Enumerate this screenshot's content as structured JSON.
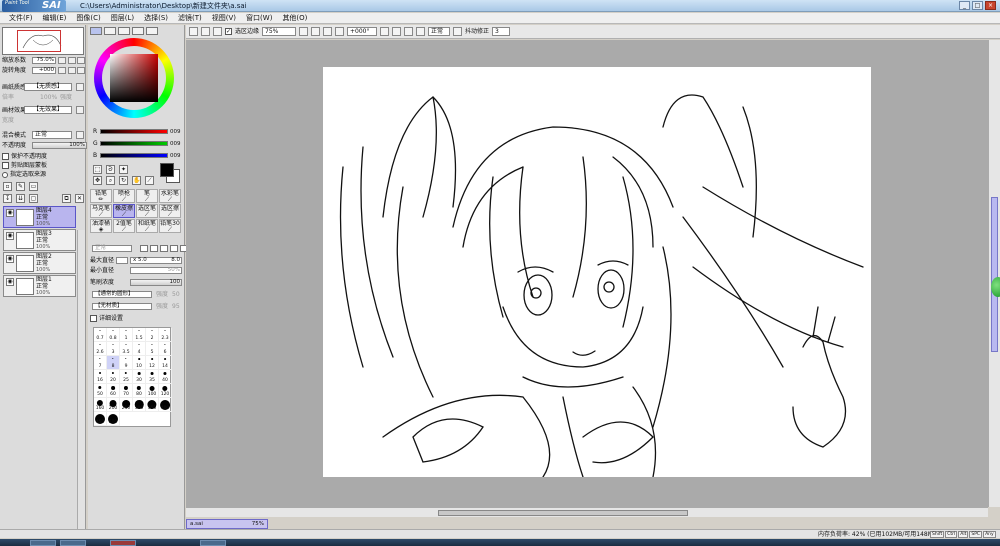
{
  "app": {
    "logo_small": "Paint Tool",
    "logo_big": "SAI",
    "title": "C:\\Users\\Administrator\\Desktop\\新建文件夹\\a.sai",
    "window_buttons": [
      "_",
      "□",
      "×"
    ]
  },
  "menu": [
    "文件(F)",
    "编辑(E)",
    "图像(C)",
    "图层(L)",
    "选择(S)",
    "滤镜(T)",
    "视图(V)",
    "窗口(W)",
    "其他(O)"
  ],
  "toolbar": {
    "selection_edge_label": "选区边缘",
    "zoom": "75%",
    "angle": "+000°",
    "mode": "正常",
    "stabilizer_label": "抖动修正",
    "stabilizer_value": "3"
  },
  "navigator": {
    "zoom_label": "缩放系数",
    "zoom_value": "75.0%",
    "rotate_label": "旋转角度",
    "rotate_value": "+000"
  },
  "texture": {
    "paper_label": "画纸质感",
    "paper_value": "【无质感】",
    "paper_sub1": "倍率",
    "paper_sub1_val": "100%",
    "paper_sub1_r": "强度",
    "paper_effect_label": "画材效果",
    "paper_effect_value": "【无效果】",
    "paper_effect_sub": "宽度"
  },
  "layer_props": {
    "blend_label": "混合模式",
    "blend_value": "正常",
    "opacity_label": "不透明度",
    "opacity_value": "100%",
    "preserve_opacity": "保护不透明度",
    "clipping": "剪贴图层蒙板",
    "selection_source": "指定选取来源"
  },
  "layers": [
    {
      "name": "图层4",
      "mode": "正常",
      "opacity": "100%",
      "selected": true
    },
    {
      "name": "图层3",
      "mode": "正常",
      "opacity": "100%",
      "selected": false
    },
    {
      "name": "图层2",
      "mode": "正常",
      "opacity": "100%",
      "selected": false
    },
    {
      "name": "图层1",
      "mode": "正常",
      "opacity": "100%",
      "selected": false
    }
  ],
  "color": {
    "rgb_labels": [
      "R",
      "G",
      "B"
    ],
    "rgb_values": [
      "009",
      "009",
      "009"
    ],
    "foreground": "#000000",
    "background": "#ffffff"
  },
  "tools": [
    {
      "label": "铅笔",
      "sel": false
    },
    {
      "label": "喷枪",
      "sel": false
    },
    {
      "label": "笔",
      "sel": false
    },
    {
      "label": "水彩笔",
      "sel": false
    },
    {
      "label": "马克笔",
      "sel": false
    },
    {
      "label": "橡皮擦",
      "sel": true
    },
    {
      "label": "选区笔",
      "sel": false
    },
    {
      "label": "选区擦",
      "sel": false
    },
    {
      "label": "油漆桶",
      "sel": false
    },
    {
      "label": "2值笔",
      "sel": false
    },
    {
      "label": "和纸笔",
      "sel": false
    },
    {
      "label": "铅笔30",
      "sel": false
    }
  ],
  "brush": {
    "mode_value": "正常",
    "max_size_label": "最大直径",
    "max_size_mult": "x 5.0",
    "max_size_value": "8.0",
    "min_size_label": "最小直径",
    "min_size_value": "50%",
    "density_label": "笔刷浓度",
    "density_value": "100",
    "shape_value": "【通常的圆形】",
    "shape_strength": "强度",
    "shape_strength_val": "50",
    "texture_value": "【无材质】",
    "texture_strength": "强度",
    "texture_strength_val": "95",
    "detail_label": "详细设置"
  },
  "brush_sizes": [
    "0.7",
    "0.8",
    "1",
    "1.5",
    "2",
    "2.3",
    "2.6",
    "3",
    "3.5",
    "4",
    "5",
    "6",
    "7",
    "8",
    "9",
    "10",
    "12",
    "14",
    "16",
    "20",
    "25",
    "30",
    "35",
    "40",
    "50",
    "60",
    "70",
    "80",
    "100",
    "120",
    "160",
    "200",
    "250",
    "300",
    "350",
    "400",
    "450",
    "500"
  ],
  "brush_selected": "8",
  "document": {
    "tab_name": "a.sai",
    "tab_zoom": "75%"
  },
  "status": {
    "memory": "内存负荷率: 42% (已用102MB/可用148MB)",
    "buttons": [
      "Shift",
      "Ctrl",
      "Alt",
      "SPC",
      "Any"
    ]
  }
}
